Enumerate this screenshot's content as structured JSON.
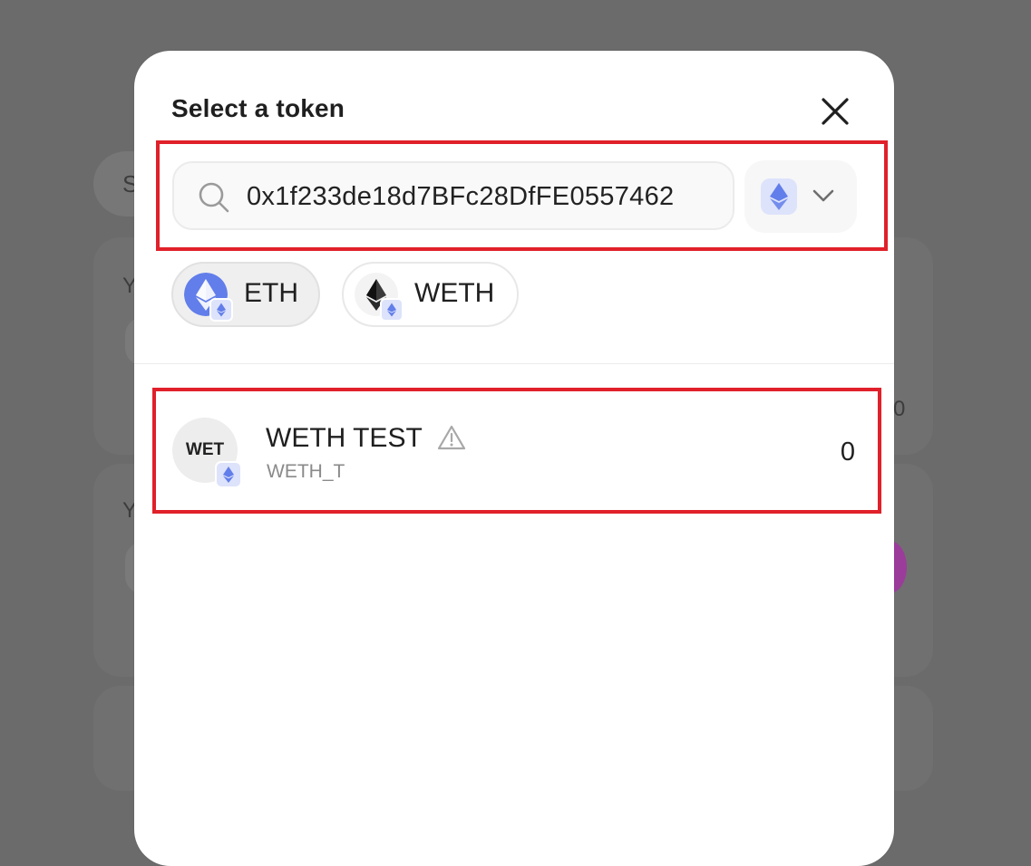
{
  "modal": {
    "title": "Select a token"
  },
  "search": {
    "value": "0x1f233de18d7BFc28DfFE0557462",
    "icon": "search-icon"
  },
  "network_selector": {
    "icon": "ethereum-icon",
    "chevron": "chevron-down-icon"
  },
  "quick_tokens": [
    {
      "label": "ETH",
      "icon": "eth-logo",
      "selected": true
    },
    {
      "label": "WETH",
      "icon": "weth-logo",
      "selected": false
    }
  ],
  "results": [
    {
      "avatar_text": "WET",
      "name": "WETH TEST",
      "symbol": "WETH_T",
      "balance": "0",
      "warning": true
    }
  ],
  "background": {
    "fragments": [
      "S",
      "Y",
      "Y",
      "0"
    ]
  },
  "colors": {
    "highlight": "#e0202a",
    "overlay": "#6b6b6b",
    "eth_blue": "#627eea"
  }
}
